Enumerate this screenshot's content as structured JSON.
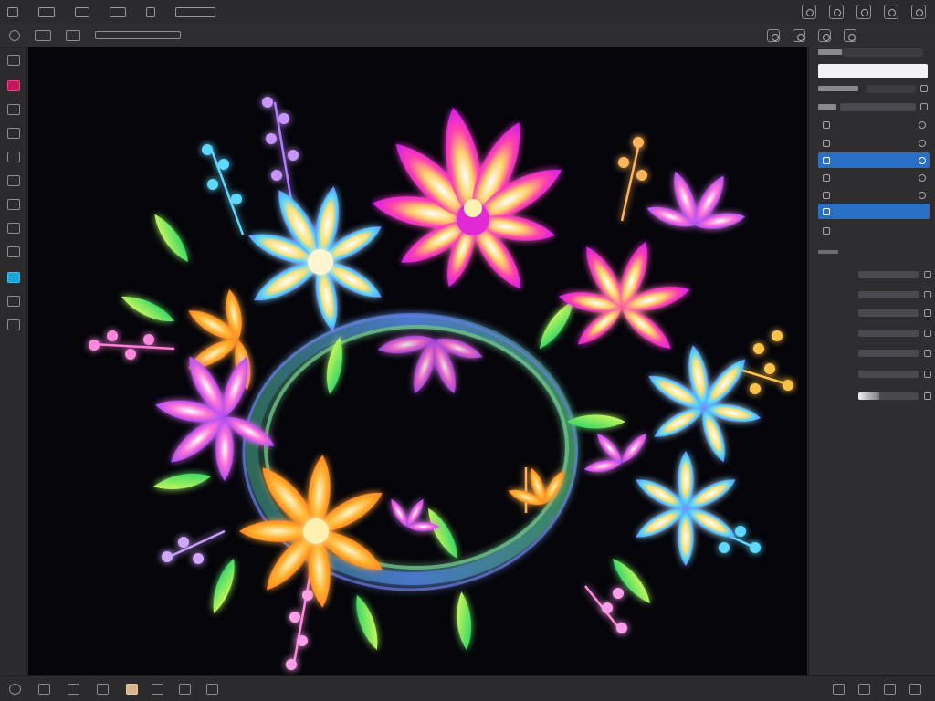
{
  "menubar": {
    "items": [
      "",
      "",
      "",
      "",
      "",
      ""
    ]
  },
  "optionsbar": {
    "panel_title": ""
  },
  "panel": {
    "layers": [
      {
        "label": "",
        "selected": false
      },
      {
        "label": "",
        "selected": false
      },
      {
        "label": "",
        "selected": true
      },
      {
        "label": "",
        "selected": false
      },
      {
        "label": "",
        "selected": false
      },
      {
        "label": "",
        "selected": true
      },
      {
        "label": "",
        "selected": false
      }
    ],
    "adjustments": [
      {
        "label": "",
        "level": 0
      },
      {
        "label": "",
        "level": 0
      },
      {
        "label": "",
        "level": 0
      },
      {
        "label": "",
        "level": 0
      },
      {
        "label": "",
        "level": 0
      },
      {
        "label": "",
        "level": 0
      },
      {
        "label": "",
        "level": 0.35
      }
    ]
  },
  "colors": {
    "accent": "#2a6fc6",
    "active_tool": "#c2185b",
    "canvas_bg": "#05050a"
  },
  "canvas": {
    "subject": "neon-flower-wreath"
  }
}
